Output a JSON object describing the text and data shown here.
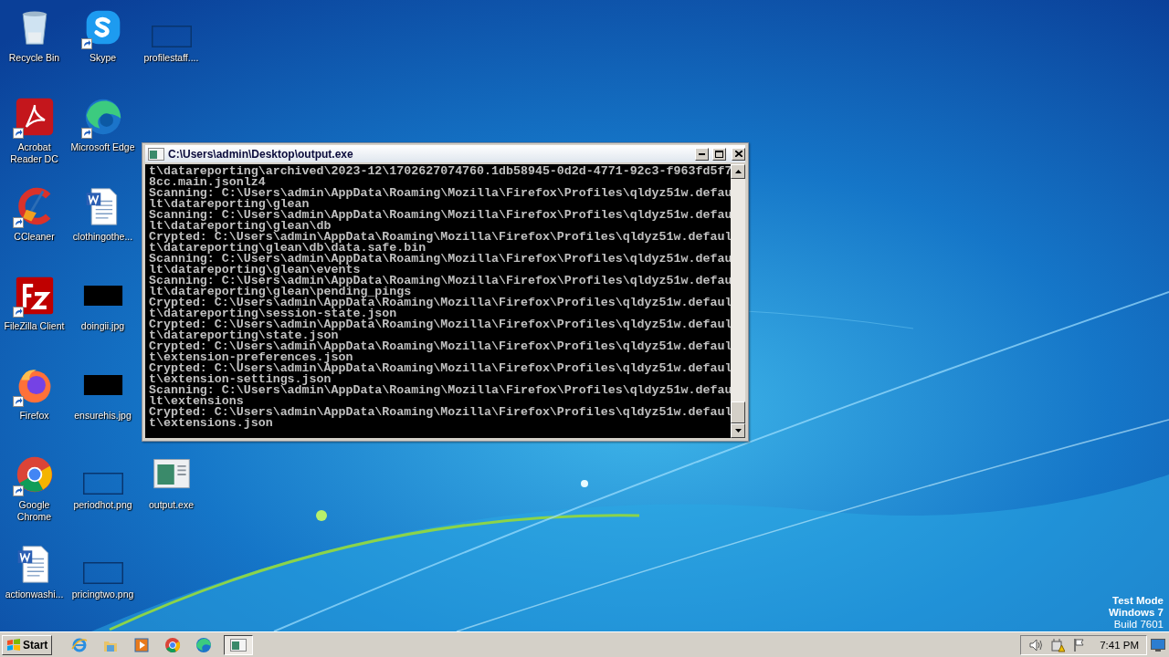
{
  "desktop": {
    "columns": [
      [
        {
          "label": "Recycle Bin",
          "kind": "recycle-bin",
          "shortcut": false
        },
        {
          "label": "Acrobat Reader DC",
          "kind": "acrobat",
          "shortcut": true
        },
        {
          "label": "CCleaner",
          "kind": "ccleaner",
          "shortcut": true
        },
        {
          "label": "FileZilla Client",
          "kind": "filezilla",
          "shortcut": true
        },
        {
          "label": "Firefox",
          "kind": "firefox",
          "shortcut": true
        },
        {
          "label": "Google Chrome",
          "kind": "chrome",
          "shortcut": true
        },
        {
          "label": "actionwashi...",
          "kind": "word",
          "shortcut": false
        }
      ],
      [
        {
          "label": "Skype",
          "kind": "skype",
          "shortcut": true
        },
        {
          "label": "Microsoft Edge",
          "kind": "edge",
          "shortcut": true
        },
        {
          "label": "clothingothe...",
          "kind": "word",
          "shortcut": false
        },
        {
          "label": "doingii.jpg",
          "kind": "dark-thumb",
          "shortcut": false
        },
        {
          "label": "ensurehis.jpg",
          "kind": "dark-thumb",
          "shortcut": false
        },
        {
          "label": "periodhot.png",
          "kind": "blank-thumb",
          "shortcut": false
        },
        {
          "label": "pricingtwo.png",
          "kind": "blank-thumb",
          "shortcut": false
        }
      ],
      [
        {
          "label": "profilestaff....",
          "kind": "blank-thumb",
          "shortcut": false
        },
        {
          "label": "output.exe",
          "kind": "app-window",
          "shortcut": false
        }
      ]
    ],
    "watermark_lines": [
      "Test Mode",
      "Windows 7",
      "Build 7601"
    ]
  },
  "console": {
    "title": "C:\\Users\\admin\\Desktop\\output.exe",
    "lines": [
      "t\\datareporting\\archived\\2023-12\\1702627074760.1db58945-0d2d-4771-92c3-f963fd5f7",
      "8cc.main.jsonlz4",
      "Scanning: C:\\Users\\admin\\AppData\\Roaming\\Mozilla\\Firefox\\Profiles\\qldyz51w.defau",
      "lt\\datareporting\\glean",
      "Scanning: C:\\Users\\admin\\AppData\\Roaming\\Mozilla\\Firefox\\Profiles\\qldyz51w.defau",
      "lt\\datareporting\\glean\\db",
      "Crypted: C:\\Users\\admin\\AppData\\Roaming\\Mozilla\\Firefox\\Profiles\\qldyz51w.defaul",
      "t\\datareporting\\glean\\db\\data.safe.bin",
      "Scanning: C:\\Users\\admin\\AppData\\Roaming\\Mozilla\\Firefox\\Profiles\\qldyz51w.defau",
      "lt\\datareporting\\glean\\events",
      "Scanning: C:\\Users\\admin\\AppData\\Roaming\\Mozilla\\Firefox\\Profiles\\qldyz51w.defau",
      "lt\\datareporting\\glean\\pending_pings",
      "Crypted: C:\\Users\\admin\\AppData\\Roaming\\Mozilla\\Firefox\\Profiles\\qldyz51w.defaul",
      "t\\datareporting\\session-state.json",
      "Crypted: C:\\Users\\admin\\AppData\\Roaming\\Mozilla\\Firefox\\Profiles\\qldyz51w.defaul",
      "t\\datareporting\\state.json",
      "Crypted: C:\\Users\\admin\\AppData\\Roaming\\Mozilla\\Firefox\\Profiles\\qldyz51w.defaul",
      "t\\extension-preferences.json",
      "Crypted: C:\\Users\\admin\\AppData\\Roaming\\Mozilla\\Firefox\\Profiles\\qldyz51w.defaul",
      "t\\extension-settings.json",
      "Scanning: C:\\Users\\admin\\AppData\\Roaming\\Mozilla\\Firefox\\Profiles\\qldyz51w.defau",
      "lt\\extensions",
      "Crypted: C:\\Users\\admin\\AppData\\Roaming\\Mozilla\\Firefox\\Profiles\\qldyz51w.defaul",
      "t\\extensions.json"
    ]
  },
  "taskbar": {
    "start_label": "Start",
    "quick_launch": [
      {
        "kind": "ie"
      },
      {
        "kind": "folder"
      },
      {
        "kind": "media"
      },
      {
        "kind": "chrome"
      },
      {
        "kind": "edge"
      }
    ],
    "tasks": [
      {
        "kind": "app-window",
        "selected": true
      }
    ],
    "tray": {
      "icons": [
        {
          "kind": "speaker"
        },
        {
          "kind": "network"
        },
        {
          "kind": "flag"
        }
      ],
      "clock": "7:41 PM"
    }
  }
}
